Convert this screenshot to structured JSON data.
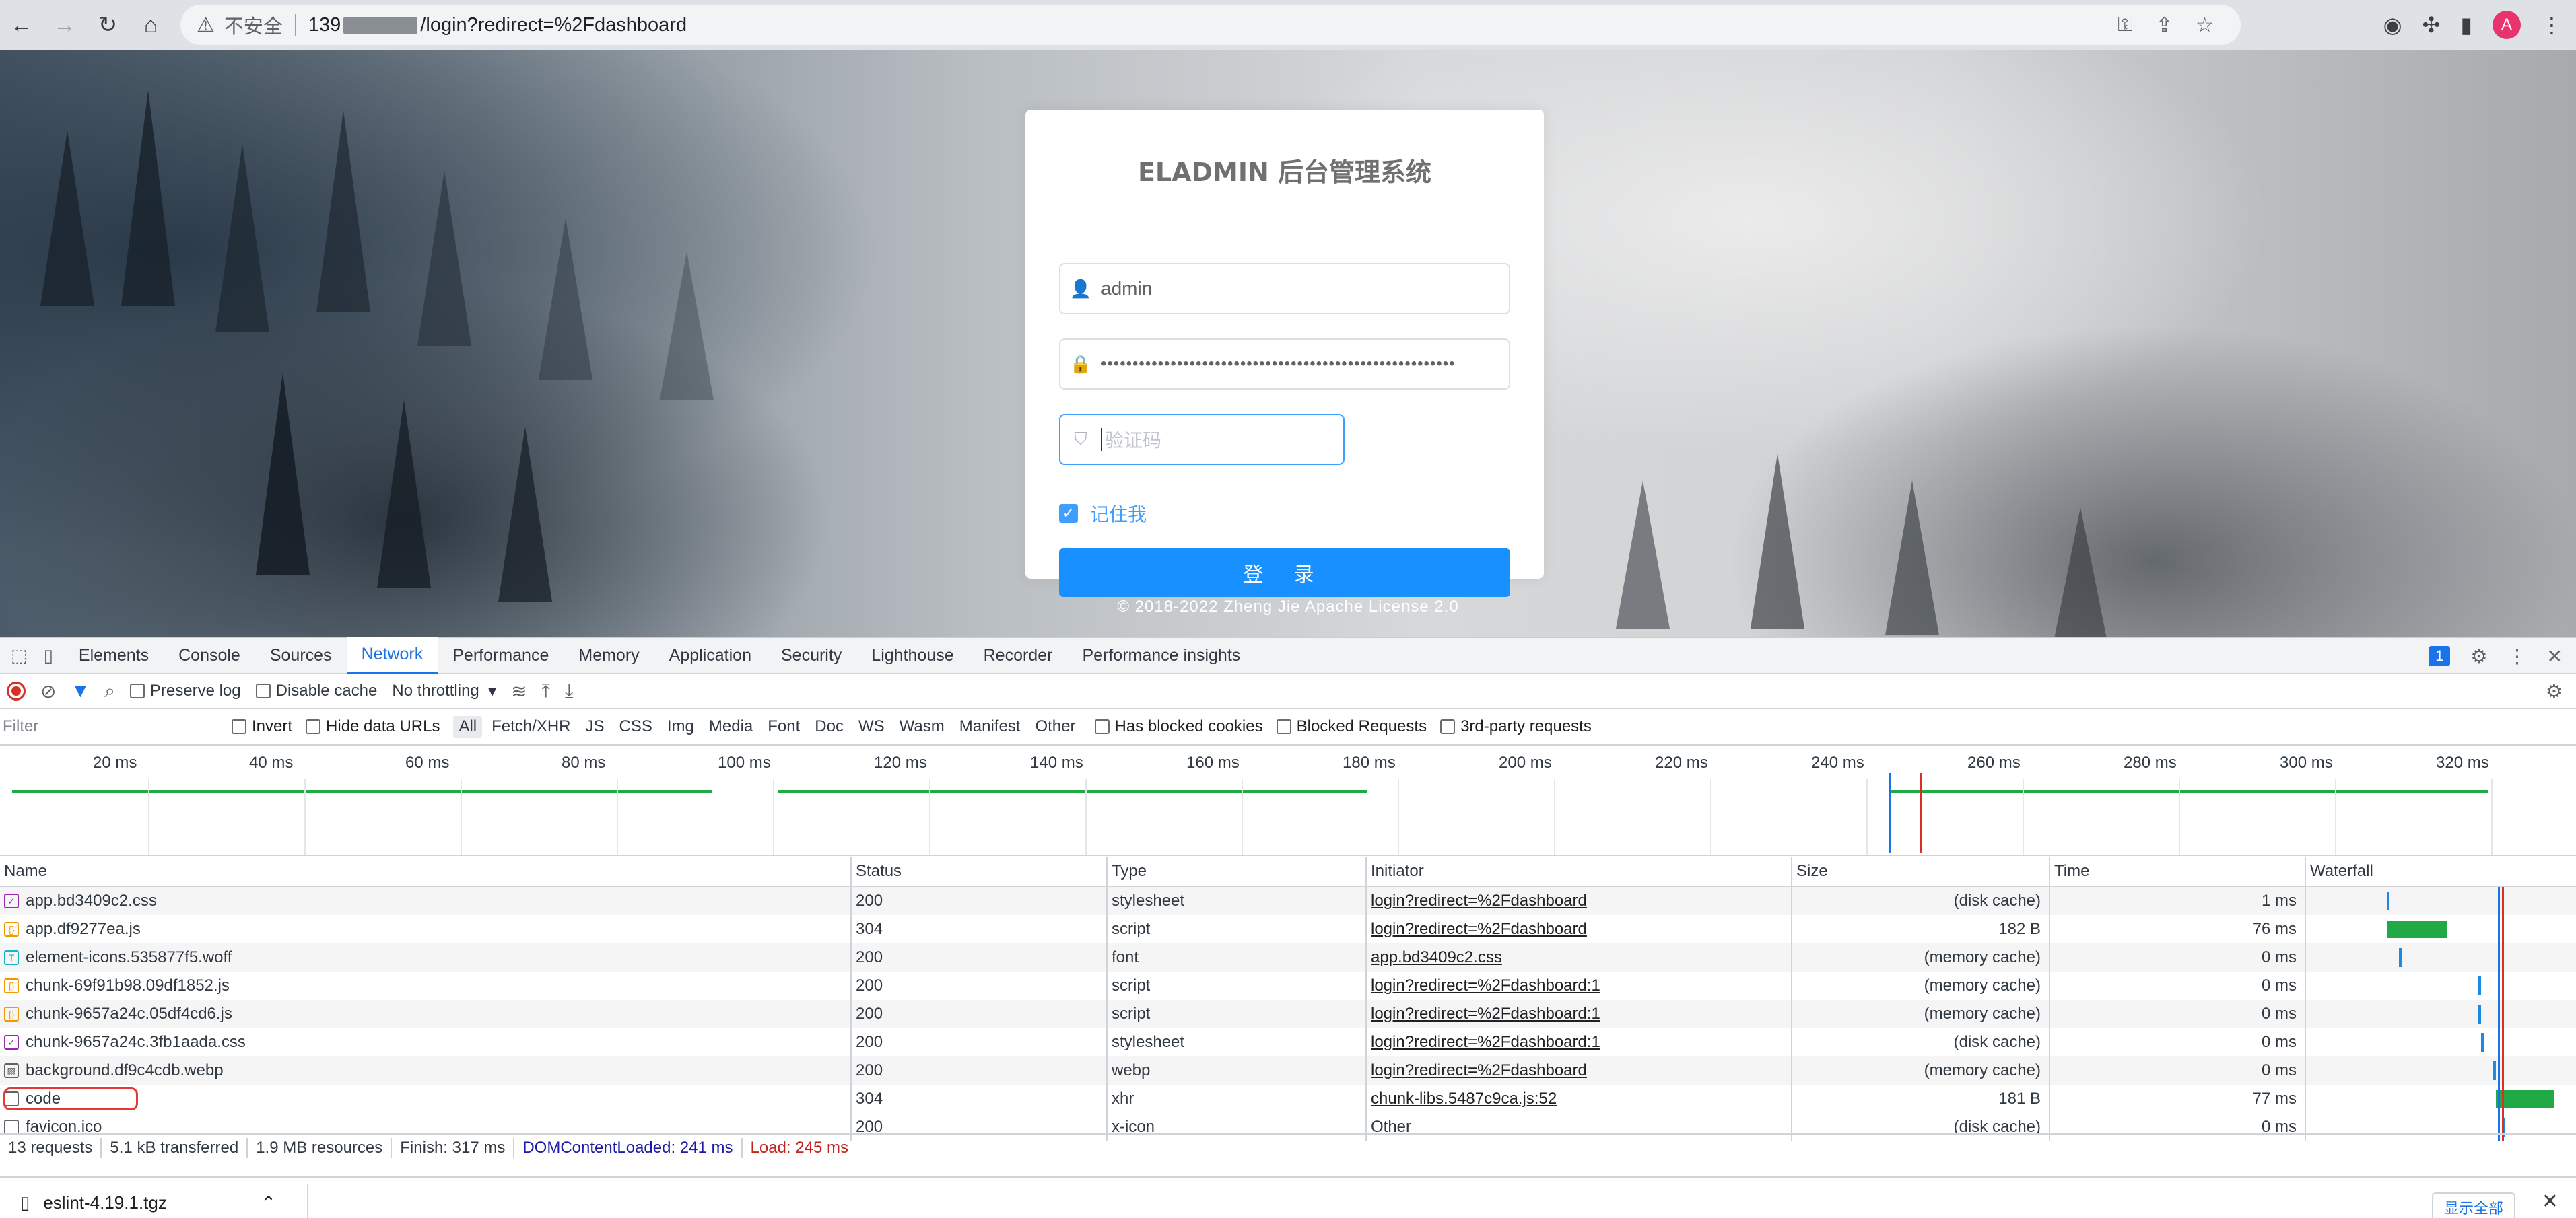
{
  "browser": {
    "security_label": "不安全",
    "url_prefix": "139",
    "url_suffix": "/login?redirect=%2Fdashboard",
    "avatar_letter": "A",
    "icons": [
      "back-icon",
      "forward-icon",
      "reload-icon",
      "home-icon",
      "warning-icon",
      "key-icon",
      "share-icon",
      "star-icon",
      "extension-icon",
      "puzzle-icon",
      "sidebar-icon"
    ]
  },
  "login": {
    "title": "ELADMIN 后台管理系统",
    "username_value": "admin",
    "password_mask": "••••••••••••••••••••••••••••••••••••••••••••••••••••••••",
    "captcha_placeholder": "验证码",
    "remember_label": "记住我",
    "remember_checked": true,
    "login_button": "登 录",
    "footer": "© 2018-2022 Zheng Jie Apache License 2.0",
    "accent_color": "#1890ff"
  },
  "devtools": {
    "tabs": [
      "Elements",
      "Console",
      "Sources",
      "Network",
      "Performance",
      "Memory",
      "Application",
      "Security",
      "Lighthouse",
      "Recorder",
      "Performance insights"
    ],
    "active_tab": "Network",
    "message_count": "1",
    "toolbar": {
      "preserve_log": "Preserve log",
      "disable_cache": "Disable cache",
      "throttling": "No throttling"
    },
    "filter": {
      "placeholder": "Filter",
      "invert": "Invert",
      "hide_data_urls": "Hide data URLs",
      "types": [
        "All",
        "Fetch/XHR",
        "JS",
        "CSS",
        "Img",
        "Media",
        "Font",
        "Doc",
        "WS",
        "Wasm",
        "Manifest",
        "Other"
      ],
      "active_type": "All",
      "has_blocked_cookies": "Has blocked cookies",
      "blocked_requests": "Blocked Requests",
      "third_party": "3rd-party requests"
    },
    "overview_ticks": [
      "20 ms",
      "40 ms",
      "60 ms",
      "80 ms",
      "100 ms",
      "120 ms",
      "140 ms",
      "160 ms",
      "180 ms",
      "200 ms",
      "220 ms",
      "240 ms",
      "260 ms",
      "280 ms",
      "300 ms",
      "320 ms"
    ],
    "columns": [
      "Name",
      "Status",
      "Type",
      "Initiator",
      "Size",
      "Time",
      "Waterfall"
    ],
    "rows": [
      {
        "name": "app.bd3409c2.css",
        "icon": "css",
        "status": "200",
        "type": "stylesheet",
        "initiator": "login?redirect=%2Fdashboard",
        "initiator_link": true,
        "size": "(disk cache)",
        "time": "1 ms"
      },
      {
        "name": "app.df9277ea.js",
        "icon": "js",
        "status": "304",
        "type": "script",
        "initiator": "login?redirect=%2Fdashboard",
        "initiator_link": true,
        "size": "182 B",
        "time": "76 ms"
      },
      {
        "name": "element-icons.535877f5.woff",
        "icon": "font",
        "status": "200",
        "type": "font",
        "initiator": "app.bd3409c2.css",
        "initiator_link": true,
        "size": "(memory cache)",
        "time": "0 ms"
      },
      {
        "name": "chunk-69f91b98.09df1852.js",
        "icon": "js",
        "status": "200",
        "type": "script",
        "initiator": "login?redirect=%2Fdashboard:1",
        "initiator_link": true,
        "size": "(memory cache)",
        "time": "0 ms"
      },
      {
        "name": "chunk-9657a24c.05df4cd6.js",
        "icon": "js",
        "status": "200",
        "type": "script",
        "initiator": "login?redirect=%2Fdashboard:1",
        "initiator_link": true,
        "size": "(memory cache)",
        "time": "0 ms"
      },
      {
        "name": "chunk-9657a24c.3fb1aada.css",
        "icon": "css",
        "status": "200",
        "type": "stylesheet",
        "initiator": "login?redirect=%2Fdashboard:1",
        "initiator_link": true,
        "size": "(disk cache)",
        "time": "0 ms"
      },
      {
        "name": "background.df9c4cdb.webp",
        "icon": "img",
        "status": "200",
        "type": "webp",
        "initiator": "login?redirect=%2Fdashboard",
        "initiator_link": true,
        "size": "(memory cache)",
        "time": "0 ms"
      },
      {
        "name": "code",
        "icon": "xhr",
        "status": "304",
        "type": "xhr",
        "initiator": "chunk-libs.5487c9ca.js:52",
        "initiator_link": true,
        "size": "181 B",
        "time": "77 ms",
        "highlighted": true
      },
      {
        "name": "favicon.ico",
        "icon": "xhr",
        "status": "200",
        "type": "x-icon",
        "initiator": "Other",
        "initiator_link": false,
        "size": "(disk cache)",
        "time": "0 ms"
      }
    ],
    "summary": {
      "requests": "13 requests",
      "transferred": "5.1 kB transferred",
      "resources": "1.9 MB resources",
      "finish": "Finish: 317 ms",
      "dcl": "DOMContentLoaded: 241 ms",
      "load": "Load: 245 ms"
    }
  },
  "download": {
    "filename": "eslint-4.19.1.tgz",
    "show_all": "显示全部"
  }
}
